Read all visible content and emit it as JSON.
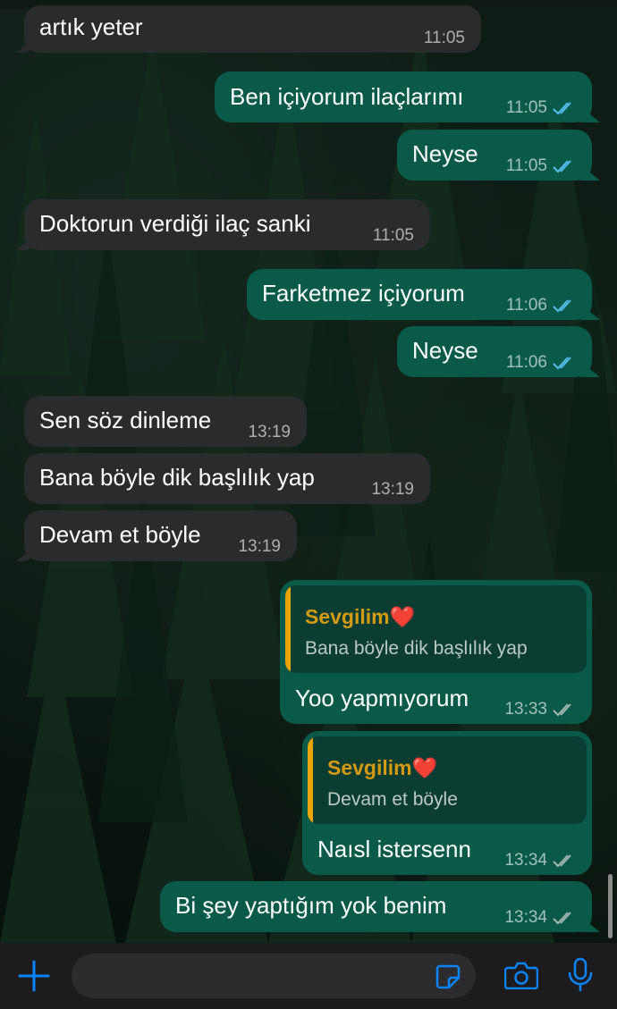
{
  "messages": [
    {
      "direction": "in",
      "text": "artık yeter",
      "time": "11:05"
    },
    {
      "direction": "out",
      "text": "Ben içiyorum ilaçlarımı",
      "time": "11:05",
      "status": "read"
    },
    {
      "direction": "out",
      "text": "Neyse",
      "time": "11:05",
      "status": "read"
    },
    {
      "direction": "in",
      "text": "Doktorun verdiği ilaç sanki",
      "time": "11:05"
    },
    {
      "direction": "out",
      "text": "Farketmez içiyorum",
      "time": "11:06",
      "status": "read"
    },
    {
      "direction": "out",
      "text": "Neyse",
      "time": "11:06",
      "status": "read"
    },
    {
      "direction": "in",
      "text": "Sen söz dinleme",
      "time": "13:19"
    },
    {
      "direction": "in",
      "text": "Bana böyle dik başlılık yap",
      "time": "13:19"
    },
    {
      "direction": "in",
      "text": "Devam et böyle",
      "time": "13:19"
    },
    {
      "direction": "out",
      "text": "Yoo yapmıyorum",
      "time": "13:33",
      "status": "delivered",
      "reply": {
        "author": "Sevgilim❤️",
        "text": "Bana böyle dik başlılık yap"
      }
    },
    {
      "direction": "out",
      "text": "Naısl istersenn",
      "time": "13:34",
      "status": "delivered",
      "reply": {
        "author": "Sevgilim❤️",
        "text": "Devam et böyle"
      }
    },
    {
      "direction": "out",
      "text": "Bi şey yaptığım yok benim",
      "time": "13:34",
      "status": "delivered"
    }
  ],
  "colors": {
    "incoming_bubble": "#2a2b2d",
    "outgoing_bubble": "#0a5a4a",
    "read_tick": "#53bdeb",
    "delivered_tick": "#a3b5b0",
    "accent": "#0a84ff",
    "reply_author": "#d39a12"
  },
  "input_bar": {
    "icons": [
      "plus-icon",
      "sticker-icon",
      "camera-icon",
      "microphone-icon"
    ],
    "placeholder": ""
  }
}
